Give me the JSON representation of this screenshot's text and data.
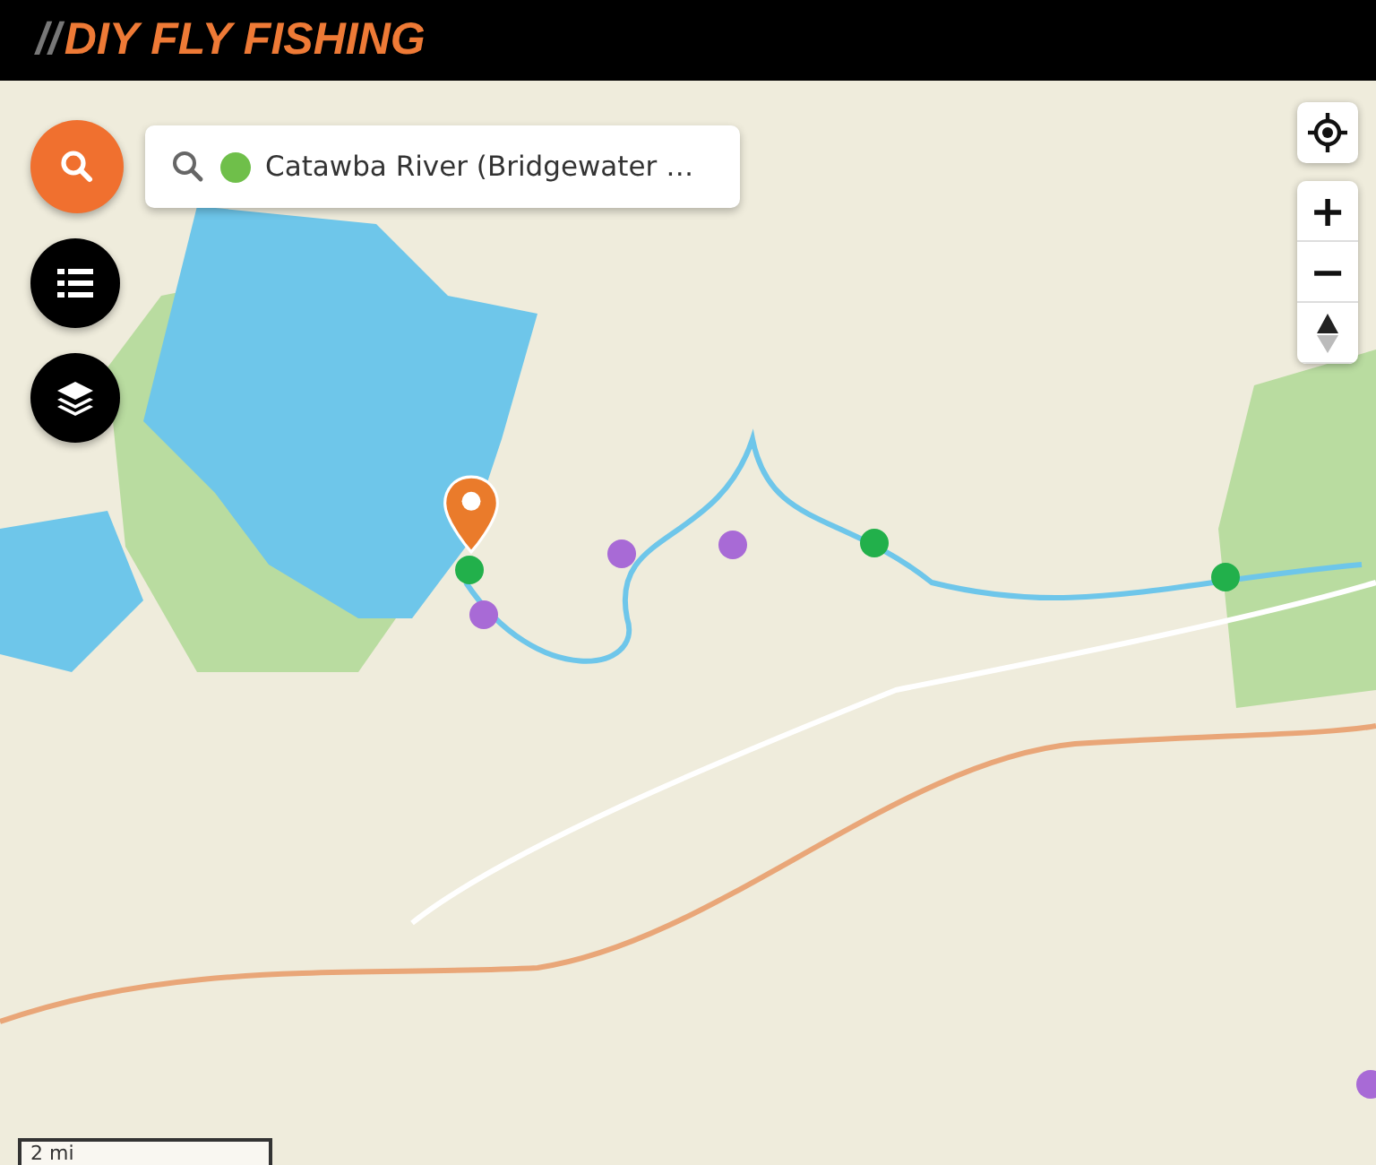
{
  "header": {
    "logo_prefix": "//",
    "title": "DIY FLY FISHING"
  },
  "search": {
    "value": "Catawba River (Bridgewater …"
  },
  "pins": [
    {
      "color": "#22b04b"
    },
    {
      "color": "#a86ad6"
    },
    {
      "color": "#a86ad6"
    },
    {
      "color": "#a86ad6"
    },
    {
      "color": "#22b04b"
    },
    {
      "color": "#22b04b"
    },
    {
      "color": "#a86ad6"
    }
  ],
  "zoom_controls": {
    "zoom_in": "+",
    "zoom_out": "−"
  },
  "scale": {
    "label": "2 mi"
  }
}
